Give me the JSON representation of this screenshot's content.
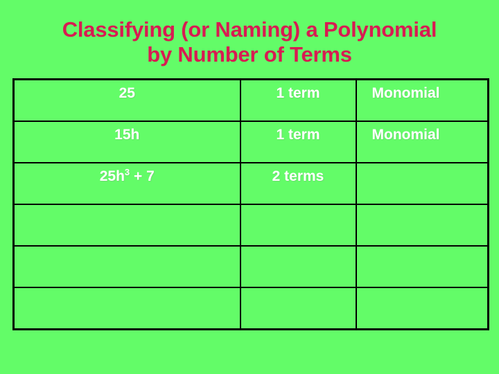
{
  "slide": {
    "background_color": "#63fc68",
    "title": {
      "color": "#d81b52",
      "line1": "Classifying (or Naming) a Polynomial",
      "line2": "by Number of Terms"
    }
  },
  "table": {
    "border_color": "#000000",
    "text_color": "#ffffff",
    "columns": 3,
    "rows": [
      {
        "polynomial": "25",
        "polynomial_superscript": "",
        "polynomial_suffix": "",
        "terms": "1 term",
        "name": "Monomial"
      },
      {
        "polynomial": "15h",
        "polynomial_superscript": "",
        "polynomial_suffix": "",
        "terms": "1 term",
        "name": "Monomial"
      },
      {
        "polynomial": "25h",
        "polynomial_superscript": "3",
        "polynomial_suffix": " + 7",
        "terms": "2 terms",
        "name": ""
      },
      {
        "polynomial": "",
        "polynomial_superscript": "",
        "polynomial_suffix": "",
        "terms": "",
        "name": ""
      },
      {
        "polynomial": "",
        "polynomial_superscript": "",
        "polynomial_suffix": "",
        "terms": "",
        "name": ""
      },
      {
        "polynomial": "",
        "polynomial_superscript": "",
        "polynomial_suffix": "",
        "terms": "",
        "name": ""
      }
    ]
  }
}
